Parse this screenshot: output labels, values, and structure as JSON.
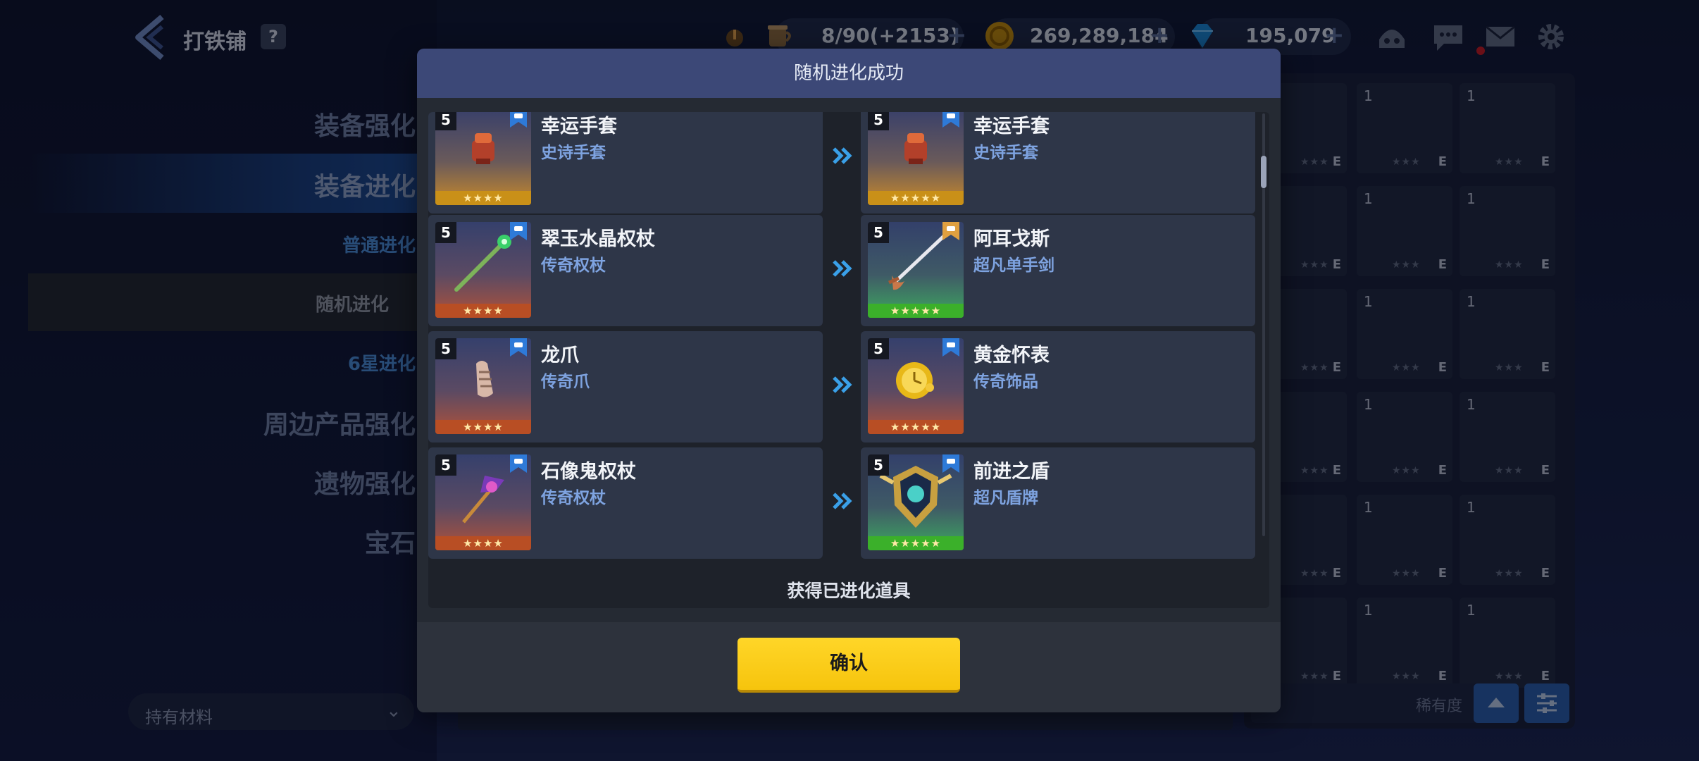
{
  "header": {
    "title": "打铁铺",
    "help": "?",
    "stamina": "8/90(+2153)",
    "gold": "269,289,184",
    "gems": "195,079",
    "plus": "+"
  },
  "sidebar": {
    "items": [
      {
        "label": "装备强化"
      },
      {
        "label": "装备进化"
      },
      {
        "label": "普通进化"
      },
      {
        "label": "随机进化"
      },
      {
        "label": "6星进化"
      },
      {
        "label": "周边产品强化"
      },
      {
        "label": "遗物强化"
      },
      {
        "label": "宝石"
      }
    ],
    "material_filter": "持有材料"
  },
  "inventory": {
    "count_label": "1",
    "grade_label": "E",
    "rarity_label": "稀有度"
  },
  "modal": {
    "title": "随机进化成功",
    "result_message": "获得已进化道具",
    "confirm_label": "确认",
    "rows": [
      {
        "before": {
          "level": "5",
          "name": "幸运手套",
          "type": "史诗手套",
          "stars": "★★★★",
          "grade": "epic"
        },
        "after": {
          "level": "5",
          "name": "幸运手套",
          "type": "史诗手套",
          "stars": "★★★★★",
          "grade": "epic"
        }
      },
      {
        "before": {
          "level": "5",
          "name": "翠玉水晶权杖",
          "type": "传奇权杖",
          "stars": "★★★★",
          "grade": "legend"
        },
        "after": {
          "level": "5",
          "name": "阿耳戈斯",
          "type": "超凡单手剑",
          "stars": "★★★★★",
          "grade": "super"
        }
      },
      {
        "before": {
          "level": "5",
          "name": "龙爪",
          "type": "传奇爪",
          "stars": "★★★★",
          "grade": "legend"
        },
        "after": {
          "level": "5",
          "name": "黄金怀表",
          "type": "传奇饰品",
          "stars": "★★★★★",
          "grade": "legend"
        }
      },
      {
        "before": {
          "level": "5",
          "name": "石像鬼权杖",
          "type": "传奇权杖",
          "stars": "★★★★",
          "grade": "legend"
        },
        "after": {
          "level": "5",
          "name": "前进之盾",
          "type": "超凡盾牌",
          "stars": "★★★★★",
          "grade": "super"
        }
      }
    ]
  },
  "colors": {
    "confirm": "#f6c40d",
    "header": "#3c4877",
    "item_type": "#7ea3e0",
    "arrow": "#3aa0e8"
  }
}
